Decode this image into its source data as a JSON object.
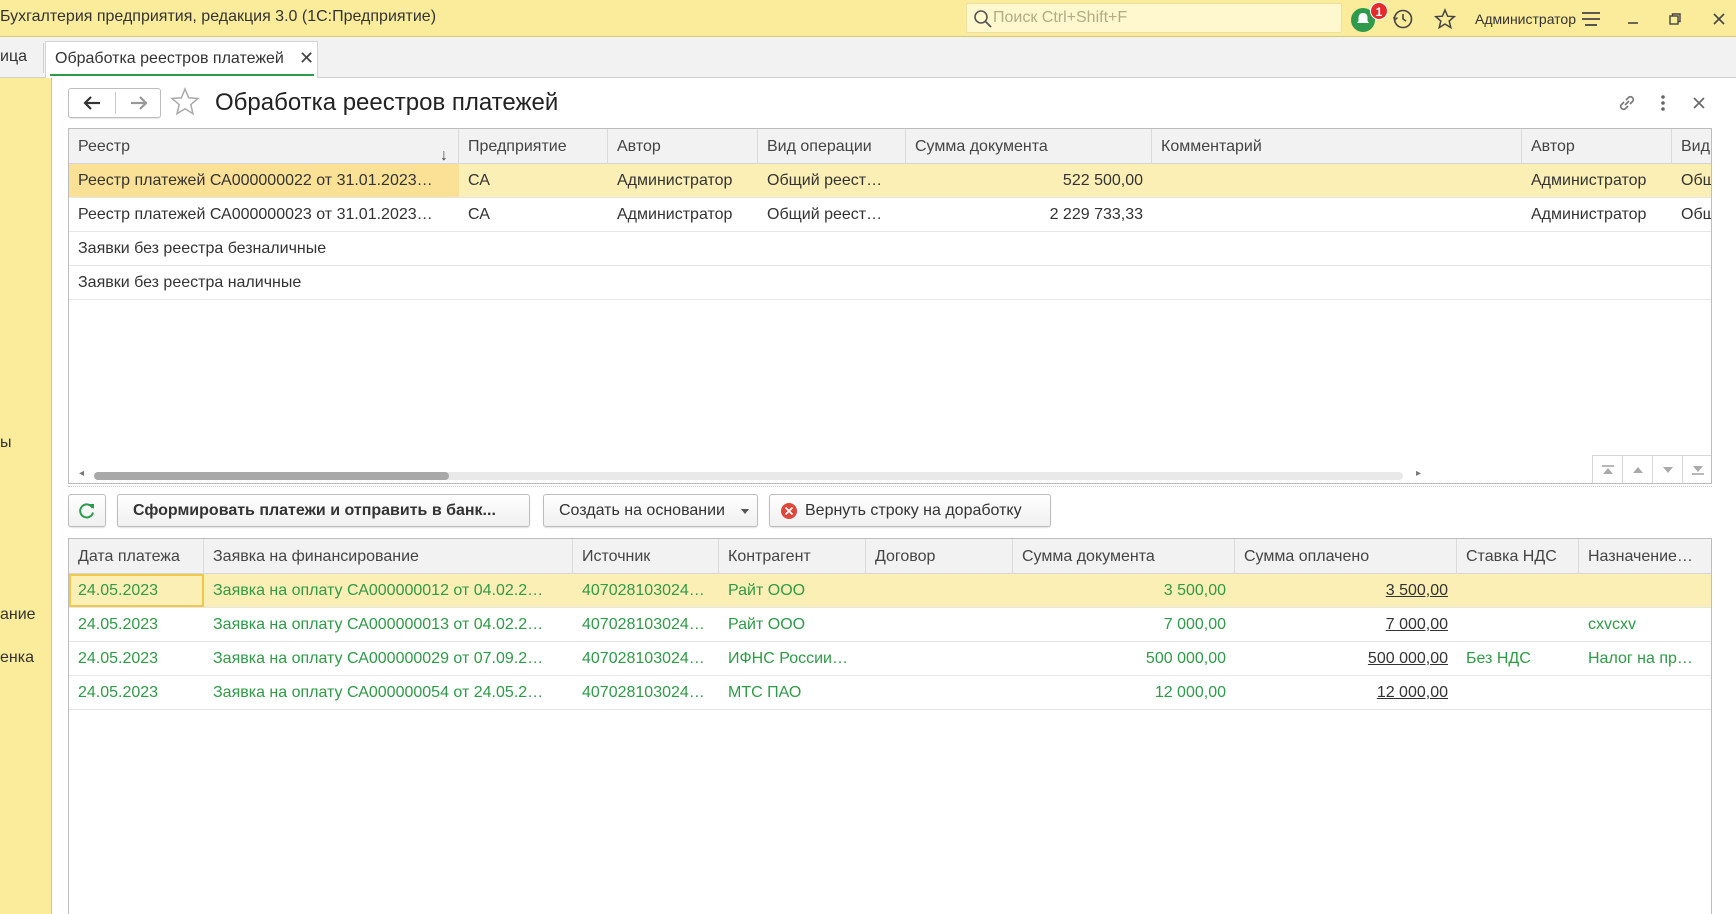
{
  "app": {
    "title": "Бухгалтерия предприятия, редакция 3.0  (1С:Предприятие)",
    "search_placeholder": "Поиск Ctrl+Shift+F",
    "notifications_count": "1",
    "user": "Администратор"
  },
  "tabs": {
    "prev_label": "ица",
    "active_label": "Обработка реестров платежей",
    "close_glyph": "✕"
  },
  "left_panel": {
    "items": [
      "ы",
      "ание",
      "енка"
    ]
  },
  "form": {
    "title": "Обработка реестров платежей"
  },
  "registers": {
    "columns": [
      "Реестр",
      "Предприятие",
      "Автор",
      "Вид операции",
      "Сумма документа",
      "Комментарий",
      "Автор",
      "Вид"
    ],
    "rows": [
      [
        "Реестр платежей СА000000022 от 31.01.2023…",
        "СА",
        "Администратор",
        "Общий реест…",
        "522 500,00",
        "",
        "Администратор",
        "Общ"
      ],
      [
        "Реестр платежей СА000000023 от 31.01.2023…",
        "СА",
        "Администратор",
        "Общий реест…",
        "2 229 733,33",
        "",
        "Администратор",
        "Общ"
      ],
      [
        "Заявки без реестра безналичные",
        "",
        "",
        "",
        "",
        "",
        "",
        ""
      ],
      [
        "Заявки без реестра наличные",
        "",
        "",
        "",
        "",
        "",
        "",
        ""
      ]
    ]
  },
  "toolbar": {
    "form_payments": "Сформировать платежи и отправить в банк...",
    "create_based_on": "Создать на основании",
    "return_row": "Вернуть строку на доработку"
  },
  "payments": {
    "columns": [
      "Дата платежа",
      "Заявка на финансирование",
      "Источник",
      "Контрагент",
      "Договор",
      "Сумма документа",
      "Сумма оплачено",
      "Ставка НДС",
      "Назначение…"
    ],
    "rows": [
      [
        "24.05.2023",
        "Заявка на оплату СА000000012 от 04.02.2…",
        "407028103024…",
        "Райт ООО",
        "",
        "3 500,00",
        "3 500,00",
        "",
        ""
      ],
      [
        "24.05.2023",
        "Заявка на оплату СА000000013 от 04.02.2…",
        "407028103024…",
        "Райт ООО",
        "",
        "7 000,00",
        "7 000,00",
        "",
        "cxvcxv"
      ],
      [
        "24.05.2023",
        "Заявка на оплату СА000000029 от 07.09.2…",
        "407028103024…",
        "ИФНС России…",
        "",
        "500 000,00",
        "500 000,00",
        "Без НДС",
        "Налог на пр…"
      ],
      [
        "24.05.2023",
        "Заявка на оплату СА000000054 от 24.05.2…",
        "407028103024…",
        "МТС ПАО",
        "",
        "12 000,00",
        "12 000,00",
        "",
        ""
      ]
    ]
  },
  "colors": {
    "panel_yellow": "#fbec9b",
    "selected_row": "#fcefb5",
    "accent_green": "#2f9a47",
    "badge_red": "#e52b2b"
  }
}
